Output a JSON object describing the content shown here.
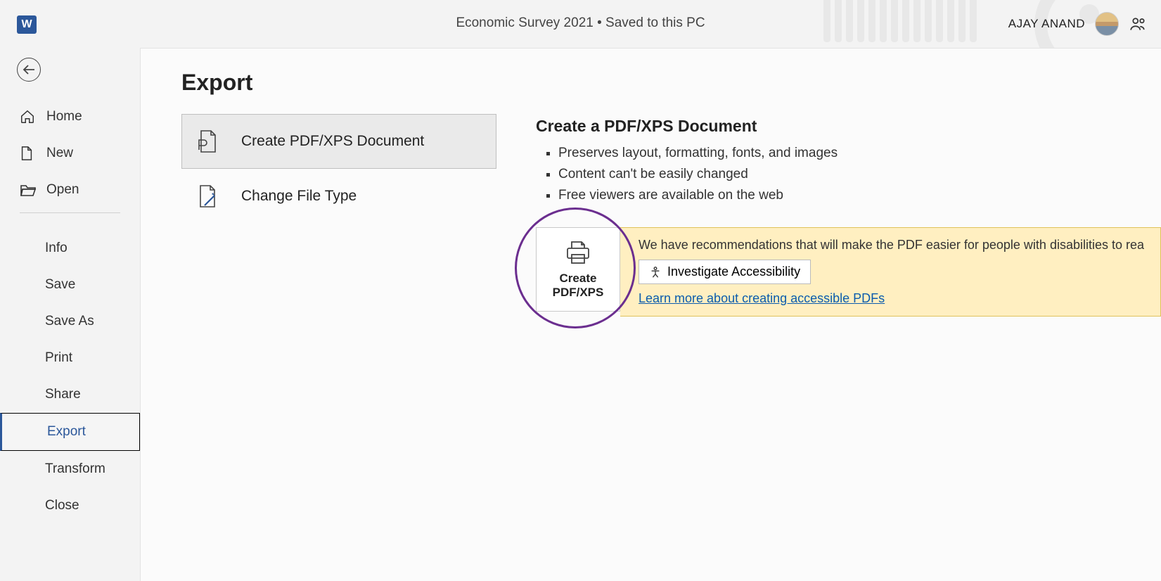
{
  "header": {
    "title": "Economic Survey 2021 • Saved to this PC",
    "user_name": "AJAY ANAND"
  },
  "sidebar": {
    "back_icon": "back",
    "primary": [
      {
        "label": "Home",
        "icon": "home"
      },
      {
        "label": "New",
        "icon": "new-doc"
      },
      {
        "label": "Open",
        "icon": "folder-open"
      }
    ],
    "secondary": [
      {
        "label": "Info"
      },
      {
        "label": "Save"
      },
      {
        "label": "Save As"
      },
      {
        "label": "Print"
      },
      {
        "label": "Share"
      },
      {
        "label": "Export",
        "active": true
      },
      {
        "label": "Transform"
      },
      {
        "label": "Close"
      }
    ]
  },
  "main": {
    "title": "Export",
    "options": [
      {
        "label": "Create PDF/XPS Document",
        "icon": "pdf-doc",
        "selected": true
      },
      {
        "label": "Change File Type",
        "icon": "change-file",
        "selected": false
      }
    ],
    "detail": {
      "heading": "Create a PDF/XPS Document",
      "bullets": [
        "Preserves layout, formatting, fonts, and images",
        "Content can't be easily changed",
        "Free viewers are available on the web"
      ],
      "button_line1": "Create",
      "button_line2": "PDF/XPS",
      "tip_text": "We have recommendations that will make the PDF easier for people with disabilities to rea",
      "investigate_label": "Investigate Accessibility",
      "learn_link": "Learn more about creating accessible PDFs"
    }
  }
}
